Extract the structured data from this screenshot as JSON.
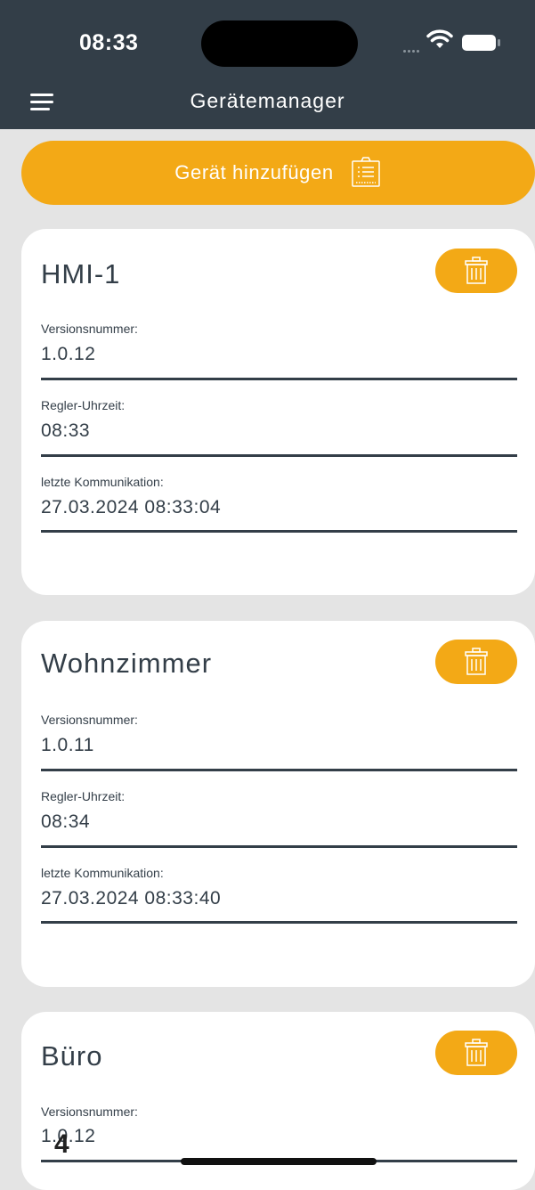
{
  "status_bar": {
    "time": "08:33"
  },
  "header": {
    "title": "Gerätemanager"
  },
  "add_device": {
    "label": "Gerät hinzufügen"
  },
  "labels": {
    "version": "Versionsnummer:",
    "controller_time": "Regler-Uhrzeit:",
    "last_communication": "letzte Kommunikation:"
  },
  "devices": [
    {
      "name": "HMI-1",
      "version": "1.0.12",
      "controller_time": "08:33",
      "last_communication": "27.03.2024 08:33:04"
    },
    {
      "name": "Wohnzimmer",
      "version": "1.0.11",
      "controller_time": "08:34",
      "last_communication": "27.03.2024 08:33:40"
    },
    {
      "name": "Büro",
      "version": "1.0.12"
    }
  ],
  "overlay": {
    "digit": "4"
  },
  "colors": {
    "header": "#333e48",
    "accent": "#f3a916",
    "background": "#e4e4e4",
    "text": "#333e48"
  }
}
